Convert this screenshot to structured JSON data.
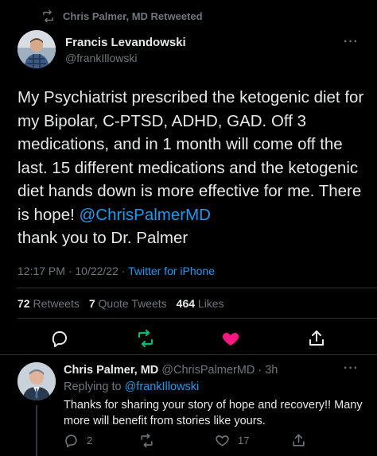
{
  "retweet_label": "Chris Palmer, MD Retweeted",
  "tweet": {
    "author_name": "Francis Levandowski",
    "author_handle": "@frankIllowski",
    "text_part1": "My Psychiatrist prescribed the ketogenic diet for my Bipolar, C-PTSD, ADHD, GAD. Off 3 medications, and in 1 month will come off the last. 15 different medications and the ketogenic diet hands down is more effective for me. There is hope! ",
    "mention": "@ChrisPalmerMD",
    "text_part2": "thank you to Dr. Palmer",
    "time": "12:17 PM · 10/22/22 · ",
    "source": "Twitter for iPhone",
    "stats": {
      "retweets_count": "72",
      "retweets_label": "Retweets",
      "quotes_count": "7",
      "quotes_label": "Quote Tweets",
      "likes_count": "464",
      "likes_label": "Likes"
    }
  },
  "reply": {
    "author_name": "Chris Palmer, MD",
    "author_handle": "@ChrisPalmerMD · 3h",
    "replying_prefix": "Replying to ",
    "replying_to": "@frankIllowski",
    "text": "Thanks for sharing your story of hope and recovery!! Many more will benefit from stories like yours.",
    "reply_count": "2",
    "like_count": "17"
  },
  "colors": {
    "background": "#000000",
    "text": "#e7e9ea",
    "muted": "#71767b",
    "accent_blue": "#1d9bf0",
    "retweet_green": "#00ba7c",
    "like_pink": "#f91880"
  },
  "icons": [
    "retweet-icon",
    "more-icon",
    "reply-icon",
    "like-icon",
    "share-icon"
  ]
}
